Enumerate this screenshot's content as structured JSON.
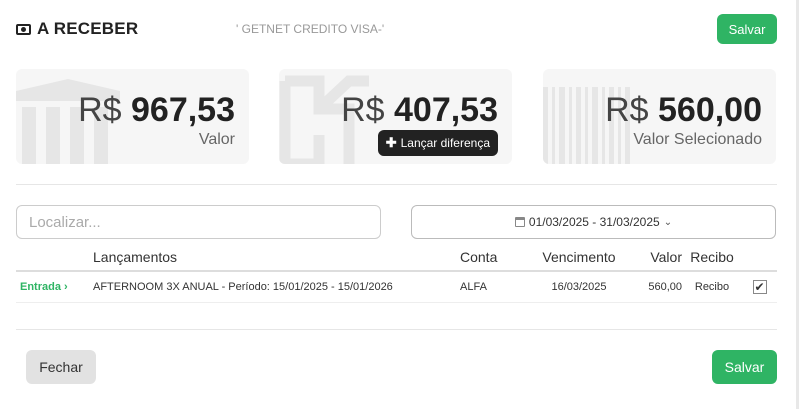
{
  "header": {
    "title": "A RECEBER",
    "subtitle": "' GETNET CREDITO VISA-'",
    "save_label": "Salvar"
  },
  "cards": [
    {
      "currency": "R$",
      "amount": "967,53",
      "label": "Valor",
      "bg_icon": "bank-icon"
    },
    {
      "currency": "R$",
      "amount": "407,53",
      "button_label": "Lançar diferença",
      "bg_icon": "puzzle-icon"
    },
    {
      "currency": "R$",
      "amount": "560,00",
      "label": "Valor Selecionado",
      "bg_icon": "barcode-icon"
    }
  ],
  "search": {
    "placeholder": "Localizar...",
    "value": ""
  },
  "date_range": {
    "label": "01/03/2025 - 31/03/2025"
  },
  "table": {
    "columns": [
      "",
      "Lançamentos",
      "Conta",
      "Vencimento",
      "Valor",
      "Recibo",
      ""
    ],
    "rows": [
      {
        "tipo": "Entrada",
        "lancamento": "AFTERNOOM 3X ANUAL - Período: 15/01/2025 - 15/01/2026",
        "conta": "ALFA",
        "vencimento": "16/03/2025",
        "valor": "560,00",
        "recibo": "Recibo",
        "checked": true
      }
    ]
  },
  "footer": {
    "close_label": "Fechar",
    "save_label": "Salvar"
  },
  "colors": {
    "accent": "#2fb464",
    "dark_button": "#222222",
    "card_bg": "#f6f6f6"
  }
}
